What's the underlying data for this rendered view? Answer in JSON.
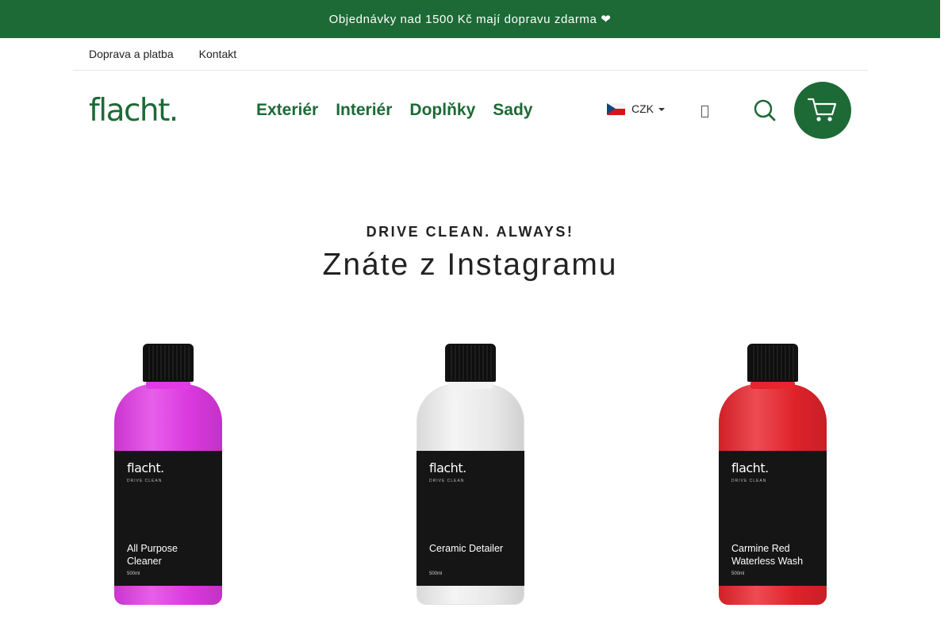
{
  "promo": {
    "text": "Objednávky nad 1500 Kč mají dopravu zdarma ❤",
    "close_glyph": "",
    "color": "#1d6a36"
  },
  "top_links": [
    "Doprava a platba",
    "Kontakt"
  ],
  "header": {
    "logo": "flacht.",
    "nav": [
      "Exteriér",
      "Interiér",
      "Doplňky",
      "Sady"
    ],
    "currency": "CZK",
    "account_glyph": ""
  },
  "section": {
    "kicker": "DRIVE CLEAN. ALWAYS!",
    "title": "Znáte z Instagramu"
  },
  "products": [
    {
      "brand": "flacht.",
      "tagline": "DRIVE CLEAN",
      "name": "All Purpose Cleaner",
      "volume": "500ml",
      "color": "#e23be6"
    },
    {
      "brand": "flacht.",
      "tagline": "DRIVE CLEAN",
      "name": "Ceramic Detailer",
      "volume": "500ml",
      "color": "#f2f2f2"
    },
    {
      "brand": "flacht.",
      "tagline": "DRIVE CLEAN",
      "name": "Carmine Red Waterless Wash",
      "volume": "500ml",
      "color": "#e8242c"
    }
  ],
  "icons": {
    "search": "search-icon",
    "cart": "cart-icon",
    "flag": "czech-flag-icon"
  }
}
